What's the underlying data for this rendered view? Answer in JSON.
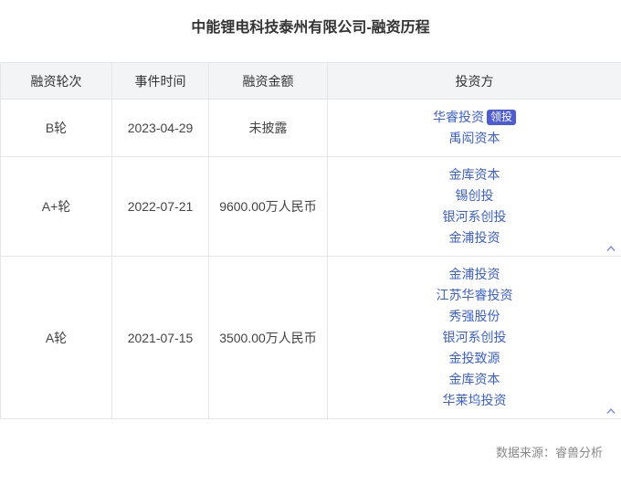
{
  "title": "中能锂电科技泰州有限公司-融资历程",
  "headers": [
    "融资轮次",
    "事件时间",
    "融资金额",
    "投资方"
  ],
  "rows": [
    {
      "round": "B轮",
      "date": "2023-04-29",
      "amount": "未披露",
      "investors": [
        {
          "name": "华睿投资",
          "badge": "领投"
        },
        {
          "name": "禹闳资本"
        }
      ],
      "collapse_icon": false
    },
    {
      "round": "A+轮",
      "date": "2022-07-21",
      "amount": "9600.00万人民币",
      "investors": [
        {
          "name": "金库资本"
        },
        {
          "name": "锡创投"
        },
        {
          "name": "银河系创投"
        },
        {
          "name": "金浦投资"
        }
      ],
      "collapse_icon": "chevron-up-icon"
    },
    {
      "round": "A轮",
      "date": "2021-07-15",
      "amount": "3500.00万人民币",
      "investors": [
        {
          "name": "金浦投资"
        },
        {
          "name": "江苏华睿投资"
        },
        {
          "name": "秀强股份"
        },
        {
          "name": "银河系创投"
        },
        {
          "name": "金投致源"
        },
        {
          "name": "金库资本"
        },
        {
          "name": "华莱坞投资"
        }
      ],
      "collapse_icon": "chevron-up-icon"
    }
  ],
  "source": "数据来源：睿兽分析",
  "colors": {
    "header_bg": "#f3f4f6",
    "border": "#e6e6e6",
    "link": "#3a5fd9",
    "badge_bg": "#4d5bd6",
    "chevron": "#7b8ce0"
  }
}
